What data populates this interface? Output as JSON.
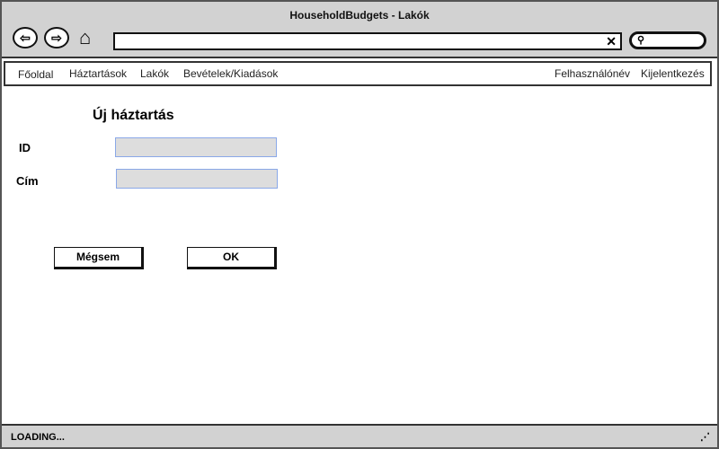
{
  "window": {
    "title": "HouseholdBudgets - Lakók"
  },
  "browser": {
    "url": "",
    "clear_icon": "✕",
    "search_icon": "⚲"
  },
  "nav": {
    "items": [
      "Főoldal",
      "Háztartások",
      "Lakók",
      "Bevételek/Kiadások"
    ],
    "user": "Felhasználónév",
    "logout": "Kijelentkezés"
  },
  "form": {
    "title": "Új háztartás",
    "id_label": "ID",
    "id_value": "",
    "address_label": "Cím",
    "address_value": "",
    "cancel": "Mégsem",
    "ok": "OK"
  },
  "status": {
    "text": "LOADING..."
  }
}
